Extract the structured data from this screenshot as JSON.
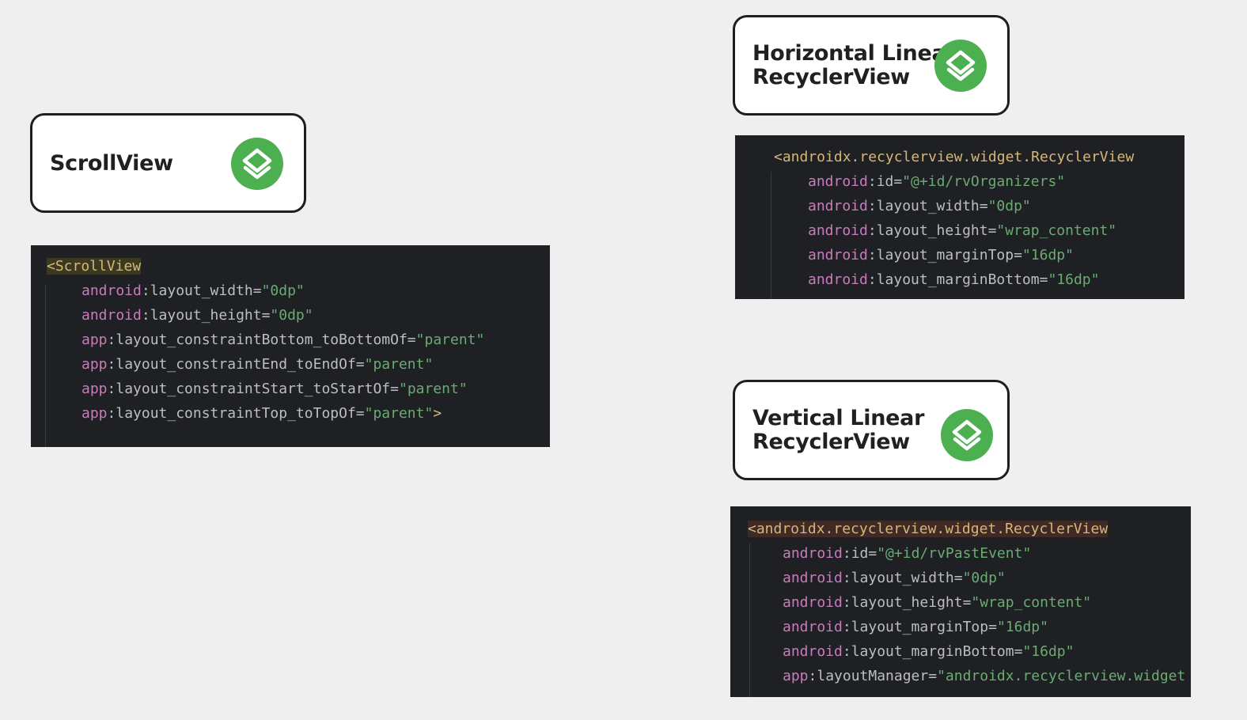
{
  "colors": {
    "background": "#efefef",
    "badge_green": "#4caf50",
    "code_background": "#1f2023",
    "tag": "#d5b778",
    "namespace": "#c77dbb",
    "attribute": "#bcbec4",
    "value": "#6aab73"
  },
  "cards": {
    "scrollview": {
      "title": "ScrollView",
      "icon": "layers-icon"
    },
    "horizontal": {
      "title_line1": "Horizontal Linear",
      "title_line2": "RecyclerView",
      "icon": "layers-icon"
    },
    "vertical": {
      "title_line1": "Vertical Linear",
      "title_line2": "RecyclerView",
      "icon": "layers-icon"
    }
  },
  "code_scrollview": {
    "tag": "<ScrollView",
    "lines": [
      {
        "ns": "android",
        "attr": ":layout_width=",
        "val": "\"0dp\""
      },
      {
        "ns": "android",
        "attr": ":layout_height=",
        "val": "\"0dp\""
      },
      {
        "ns": "app",
        "attr": ":layout_constraintBottom_toBottomOf=",
        "val": "\"parent\""
      },
      {
        "ns": "app",
        "attr": ":layout_constraintEnd_toEndOf=",
        "val": "\"parent\""
      },
      {
        "ns": "app",
        "attr": ":layout_constraintStart_toStartOf=",
        "val": "\"parent\""
      },
      {
        "ns": "app",
        "attr": ":layout_constraintTop_toTopOf=",
        "val": "\"parent\"",
        "close": ">"
      }
    ]
  },
  "code_horizontal": {
    "tag": "<androidx.recyclerview.widget.RecyclerView",
    "lines": [
      {
        "ns": "android",
        "attr": ":id=",
        "val": "\"@+id/rvOrganizers\""
      },
      {
        "ns": "android",
        "attr": ":layout_width=",
        "val": "\"0dp\""
      },
      {
        "ns": "android",
        "attr": ":layout_height=",
        "val": "\"wrap_content\""
      },
      {
        "ns": "android",
        "attr": ":layout_marginTop=",
        "val": "\"16dp\""
      },
      {
        "ns": "android",
        "attr": ":layout_marginBottom=",
        "val": "\"16dp\""
      }
    ]
  },
  "code_vertical": {
    "tag": "<androidx.recyclerview.widget.RecyclerView",
    "lines": [
      {
        "ns": "android",
        "attr": ":id=",
        "val": "\"@+id/rvPastEvent\""
      },
      {
        "ns": "android",
        "attr": ":layout_width=",
        "val": "\"0dp\""
      },
      {
        "ns": "android",
        "attr": ":layout_height=",
        "val": "\"wrap_content\""
      },
      {
        "ns": "android",
        "attr": ":layout_marginTop=",
        "val": "\"16dp\""
      },
      {
        "ns": "android",
        "attr": ":layout_marginBottom=",
        "val": "\"16dp\""
      },
      {
        "ns": "app",
        "attr": ":layoutManager=",
        "val": "\"androidx.recyclerview.widget"
      }
    ]
  }
}
